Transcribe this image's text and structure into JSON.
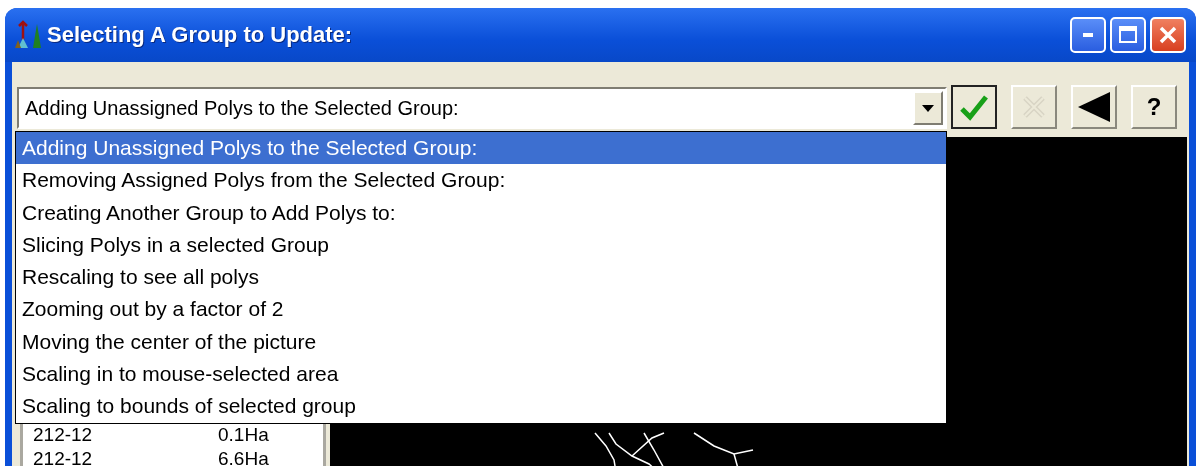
{
  "window": {
    "title": "Selecting A Group to Update:"
  },
  "combo": {
    "value": "Adding Unassigned Polys to the Selected Group:"
  },
  "toolbar": [
    {
      "kind": "ok"
    },
    {
      "kind": "cancel",
      "disabled": true
    },
    {
      "kind": "back"
    },
    {
      "kind": "help",
      "label": "?"
    }
  ],
  "dropdown": [
    {
      "label": "Adding Unassigned Polys to the Selected Group:",
      "selected": true
    },
    {
      "label": "Removing Assigned Polys from the Selected Group:",
      "selected": false
    },
    {
      "label": "Creating Another Group to Add Polys to:",
      "selected": false
    },
    {
      "label": "Slicing Polys in a selected Group",
      "selected": false
    },
    {
      "label": "Rescaling to see all polys",
      "selected": false
    },
    {
      "label": "Zooming out by a factor of 2",
      "selected": false
    },
    {
      "label": "Moving the center of the picture",
      "selected": false
    },
    {
      "label": "Scaling in to mouse-selected area",
      "selected": false
    },
    {
      "label": "Scaling to bounds of selected group",
      "selected": false
    }
  ],
  "polys": [
    {
      "name": "212-12",
      "area": "0.1Ha"
    },
    {
      "name": "212-12",
      "area": "6.6Ha"
    }
  ]
}
